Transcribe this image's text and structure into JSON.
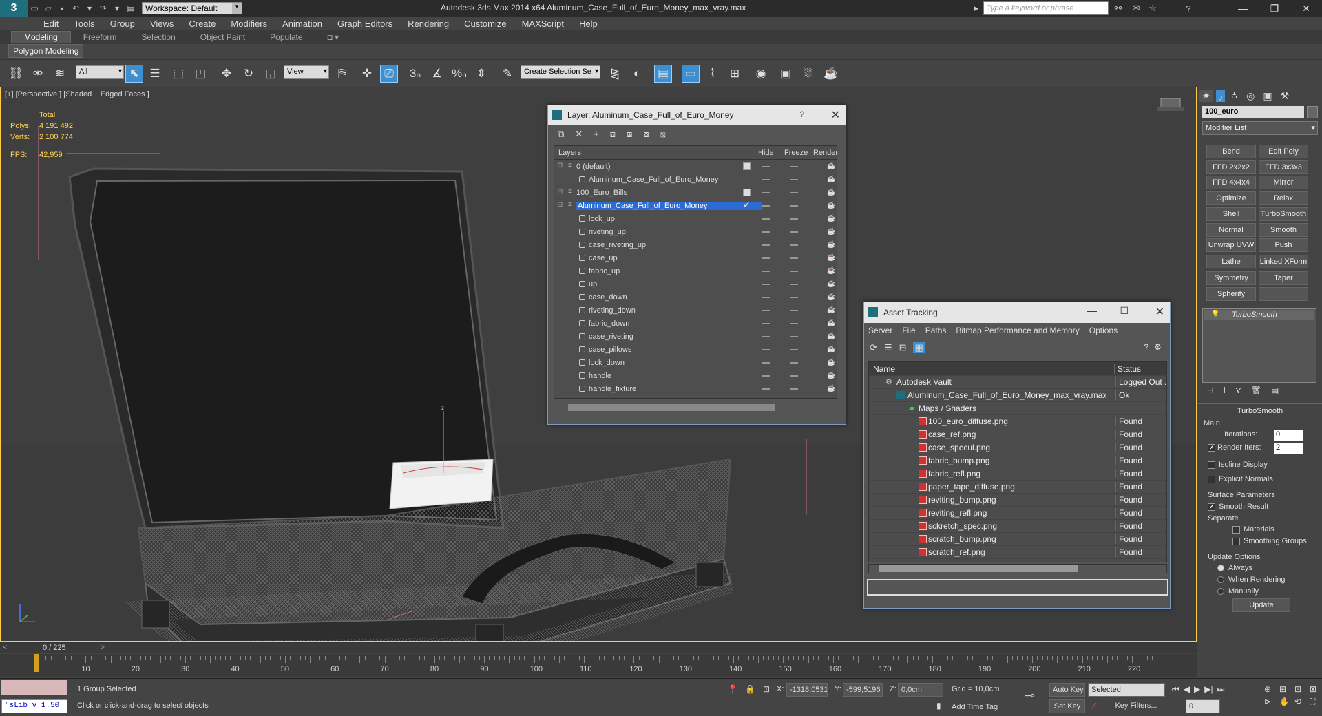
{
  "title_bar": {
    "workspace": "Workspace: Default",
    "title": "Autodesk 3ds Max  2014 x64      Aluminum_Case_Full_of_Euro_Money_max_vray.max",
    "search_placeholder": "Type a keyword or phrase"
  },
  "menu": [
    "Edit",
    "Tools",
    "Group",
    "Views",
    "Create",
    "Modifiers",
    "Animation",
    "Graph Editors",
    "Rendering",
    "Customize",
    "MAXScript",
    "Help"
  ],
  "ribbon_tabs": [
    "Modeling",
    "Freeform",
    "Selection",
    "Object Paint",
    "Populate"
  ],
  "polygon_modeling": "Polygon Modeling",
  "toolbar": {
    "filter": "All",
    "ref_coord": "View",
    "selection_set": "Create Selection Se",
    "snap_3": "3",
    "percent": "%"
  },
  "viewport": {
    "label": "[+] [Perspective ] [Shaded + Edged Faces ]",
    "total_label": "Total",
    "polys_label": "Polys:",
    "polys_value": "4 191 492",
    "verts_label": "Verts:",
    "verts_value": "2 100 774",
    "fps_label": "FPS:",
    "fps_value": "42,959"
  },
  "layer_dialog": {
    "title": "Layer: Aluminum_Case_Full_of_Euro_Money",
    "help": "?",
    "columns": {
      "layers": "Layers",
      "hide": "Hide",
      "freeze": "Freeze",
      "render": "Render"
    },
    "rows": [
      {
        "name": "0 (default)",
        "indent": 0,
        "type": "layer"
      },
      {
        "name": "Aluminum_Case_Full_of_Euro_Money",
        "indent": 1,
        "type": "object"
      },
      {
        "name": "100_Euro_Bills",
        "indent": 0,
        "type": "layer"
      },
      {
        "name": "Aluminum_Case_Full_of_Euro_Money",
        "indent": 0,
        "type": "layer",
        "selected": true
      },
      {
        "name": "lock_up",
        "indent": 1,
        "type": "object"
      },
      {
        "name": "riveting_up",
        "indent": 1,
        "type": "object"
      },
      {
        "name": "case_riveting_up",
        "indent": 1,
        "type": "object"
      },
      {
        "name": "case_up",
        "indent": 1,
        "type": "object"
      },
      {
        "name": "fabric_up",
        "indent": 1,
        "type": "object"
      },
      {
        "name": "up",
        "indent": 1,
        "type": "object"
      },
      {
        "name": "case_down",
        "indent": 1,
        "type": "object"
      },
      {
        "name": "riveting_down",
        "indent": 1,
        "type": "object"
      },
      {
        "name": "fabric_down",
        "indent": 1,
        "type": "object"
      },
      {
        "name": "case_riveting",
        "indent": 1,
        "type": "object"
      },
      {
        "name": "case_pillows",
        "indent": 1,
        "type": "object"
      },
      {
        "name": "lock_down",
        "indent": 1,
        "type": "object"
      },
      {
        "name": "handle",
        "indent": 1,
        "type": "object"
      },
      {
        "name": "handle_fixture",
        "indent": 1,
        "type": "object"
      }
    ]
  },
  "asset_tracking": {
    "title": "Asset Tracking",
    "menu": [
      "Server",
      "File",
      "Paths",
      "Bitmap Performance and Memory",
      "Options"
    ],
    "col_name": "Name",
    "col_status": "Status",
    "rows": [
      {
        "name": "Autodesk Vault",
        "status": "Logged Out ...",
        "level": 0
      },
      {
        "name": "Aluminum_Case_Full_of_Euro_Money_max_vray.max",
        "status": "Ok",
        "level": 1
      },
      {
        "name": "Maps / Shaders",
        "status": "",
        "level": 2
      },
      {
        "name": "100_euro_diffuse.png",
        "status": "Found",
        "level": 3
      },
      {
        "name": "case_ref.png",
        "status": "Found",
        "level": 3
      },
      {
        "name": "case_specul.png",
        "status": "Found",
        "level": 3
      },
      {
        "name": "fabric_bump.png",
        "status": "Found",
        "level": 3
      },
      {
        "name": "fabric_refl.png",
        "status": "Found",
        "level": 3
      },
      {
        "name": "paper_tape_diffuse.png",
        "status": "Found",
        "level": 3
      },
      {
        "name": "reviting_bump.png",
        "status": "Found",
        "level": 3
      },
      {
        "name": "reviting_refl.png",
        "status": "Found",
        "level": 3
      },
      {
        "name": "sckretch_spec.png",
        "status": "Found",
        "level": 3
      },
      {
        "name": "scratch_bump.png",
        "status": "Found",
        "level": 3
      },
      {
        "name": "scratch_ref.png",
        "status": "Found",
        "level": 3
      }
    ]
  },
  "command_panel": {
    "object_name": "100_euro",
    "modifier_list": "Modifier List",
    "buttons": [
      "Bend",
      "Edit Poly",
      "FFD 2x2x2",
      "FFD 3x3x3",
      "FFD 4x4x4",
      "Mirror",
      "Optimize",
      "Relax",
      "Shell",
      "TurboSmooth",
      "Normal",
      "Smooth",
      "Unwrap UVW",
      "Push",
      "Lathe",
      "Linked XForm",
      "Symmetry",
      "Taper",
      "Spherify",
      ""
    ],
    "stack_item": "TurboSmooth",
    "rollout_title": "TurboSmooth",
    "main_label": "Main",
    "iterations_label": "Iterations:",
    "iterations_value": "0",
    "render_iters_label": "Render Iters:",
    "render_iters_value": "2",
    "isoline": "Isoline Display",
    "explicit_normals": "Explicit Normals",
    "surface_params": "Surface Parameters",
    "smooth_result": "Smooth Result",
    "separate": "Separate",
    "materials": "Materials",
    "smoothing_groups": "Smoothing Groups",
    "update_options": "Update Options",
    "always": "Always",
    "when_rendering": "When Rendering",
    "manually": "Manually",
    "update": "Update"
  },
  "timeline": {
    "frame": "0 / 225",
    "ticks": [
      "10",
      "20",
      "30",
      "40",
      "50",
      "60",
      "70",
      "80",
      "90",
      "100",
      "110",
      "120",
      "130",
      "140",
      "150",
      "160",
      "170",
      "180",
      "190",
      "200",
      "210",
      "220"
    ]
  },
  "status": {
    "script": "\"sLib v 1.50",
    "selected": "1 Group Selected",
    "prompt": "Click or click-and-drag to select objects",
    "x_label": "X:",
    "x_value": "-1318,0531",
    "y_label": "Y:",
    "y_value": "-599,5196",
    "z_label": "Z:",
    "z_value": "0,0cm",
    "grid": "Grid = 10,0cm",
    "add_time_tag": "Add Time Tag",
    "auto_key": "Auto Key",
    "set_key": "Set Key",
    "key_mode": "Selected",
    "key_filters": "Key Filters...",
    "frame_field": "0"
  }
}
